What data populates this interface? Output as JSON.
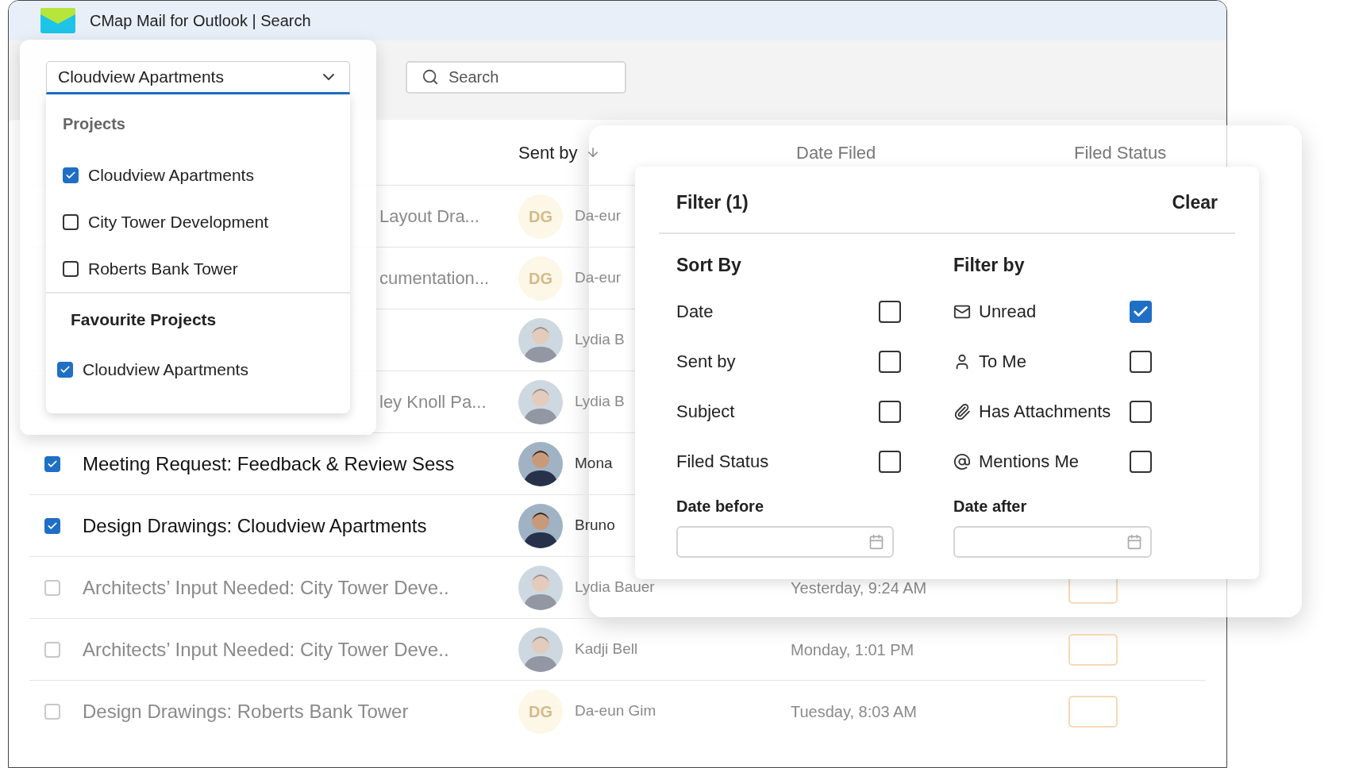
{
  "window": {
    "title": "CMap Mail for Outlook | Search"
  },
  "toolbar": {
    "search": {
      "placeholder": "Search"
    }
  },
  "project_dropdown": {
    "value": "Cloudview Apartments",
    "expanded": true,
    "sections": [
      {
        "kind": "group",
        "title": "Projects",
        "items": [
          {
            "label": "Cloudview Apartments",
            "checked": true
          },
          {
            "label": "City Tower Development",
            "checked": false
          },
          {
            "label": "Roberts Bank Tower",
            "checked": false
          }
        ]
      },
      {
        "kind": "favourites",
        "title": "Favourite Projects",
        "items": [
          {
            "label": "Cloudview Apartments",
            "checked": true
          }
        ]
      }
    ]
  },
  "table": {
    "columns": [
      {
        "label": "Sent by",
        "sorted": true
      },
      {
        "label": "Date Filed",
        "sorted": false
      },
      {
        "label": "Filed Status",
        "sorted": false
      }
    ],
    "rows": [
      {
        "kind": "partial",
        "subject": "Layout Dra...",
        "avatar": {
          "kind": "initials",
          "text": "DG"
        },
        "sender": "Da-eur"
      },
      {
        "kind": "partial",
        "subject": "cumentation...",
        "avatar": {
          "kind": "initials",
          "text": "DG"
        },
        "sender": "Da-eur"
      },
      {
        "kind": "partial",
        "avatar": {
          "kind": "photo"
        },
        "sender": "Lydia B"
      },
      {
        "kind": "partial",
        "subject": "ley Knoll Pa...",
        "avatar": {
          "kind": "photo"
        },
        "sender": "Lydia B"
      },
      {
        "kind": "full",
        "checked": true,
        "subject": "Meeting Request: Feedback & Review Sess",
        "avatar": {
          "kind": "photo"
        },
        "sender": "Mona"
      },
      {
        "kind": "full",
        "checked": true,
        "subject": "Design Drawings: Cloudview Apartments",
        "avatar": {
          "kind": "photo"
        },
        "sender": "Bruno"
      },
      {
        "kind": "full",
        "checked": false,
        "subject": "Architects’ Input Needed: City Tower Deve..",
        "avatar": {
          "kind": "photo"
        },
        "sender": "Lydia Bauer",
        "date": "Yesterday, 9:24 AM"
      },
      {
        "kind": "full",
        "checked": false,
        "subject": "Architects’ Input Needed: City Tower Deve..",
        "avatar": {
          "kind": "photo"
        },
        "sender": "Kadji Bell",
        "date": "Monday, 1:01 PM"
      },
      {
        "kind": "full",
        "checked": false,
        "subject": "Design Drawings: Roberts Bank Tower",
        "avatar": {
          "kind": "initials",
          "text": "DG"
        },
        "sender": "Da-eun Gim",
        "date": "Tuesday, 8:03 AM"
      }
    ]
  },
  "filter_panel": {
    "title": "Filter (1)",
    "clear": "Clear",
    "sort_by": {
      "title": "Sort By",
      "items": [
        {
          "label": "Date",
          "checked": false
        },
        {
          "label": "Sent by",
          "checked": false
        },
        {
          "label": "Subject",
          "checked": false
        },
        {
          "label": "Filed Status",
          "checked": false
        }
      ]
    },
    "filter_by": {
      "title": "Filter by",
      "items": [
        {
          "label": "Unread",
          "checked": true
        },
        {
          "label": "To Me",
          "checked": false
        },
        {
          "label": "Has Attachments",
          "checked": false
        },
        {
          "label": "Mentions Me",
          "checked": false
        }
      ]
    },
    "date_before": {
      "label": "Date before"
    },
    "date_after": {
      "label": "Date after"
    }
  }
}
